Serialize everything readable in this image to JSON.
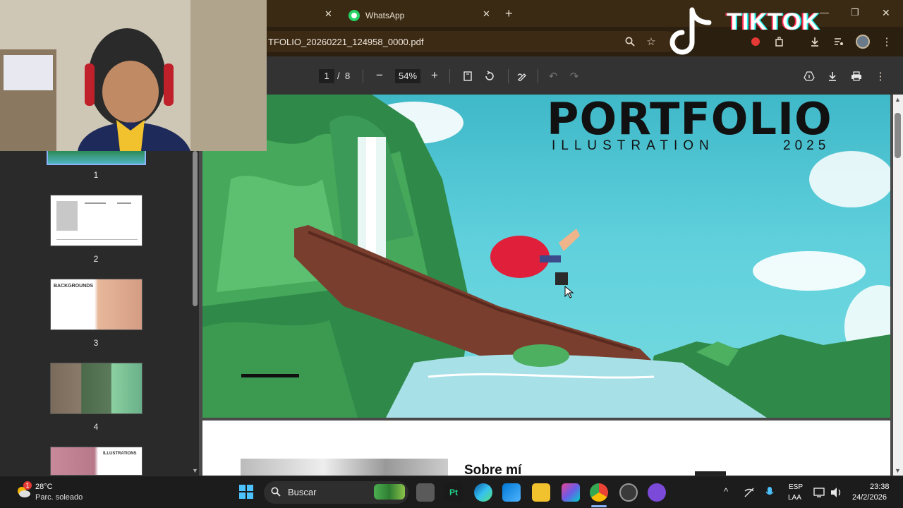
{
  "browser": {
    "tabs": [
      {
        "label": "",
        "close_glyph": "✕"
      },
      {
        "label": "WhatsApp",
        "close_glyph": "✕"
      }
    ],
    "new_tab_glyph": "+",
    "window_controls": {
      "minimize": "—",
      "restore": "❐",
      "close": "✕"
    },
    "url": "TFOLIO_20260221_124958_0000.pdf",
    "icons": [
      "zoom-icon",
      "star-icon",
      "extension-icon",
      "record-icon",
      "puzzle-icon",
      "download-icon",
      "media-icon",
      "profile-avatar",
      "menu-icon"
    ],
    "menu_glyph": "⋮"
  },
  "overlay": {
    "tiktok_text": "TIKTOK"
  },
  "pdf_toolbar": {
    "current_page": "1",
    "page_separator": "/",
    "total_pages": "8",
    "zoom_out_glyph": "−",
    "zoom_value": "54%",
    "zoom_in_glyph": "+",
    "menu_glyph": "⋮"
  },
  "sidebar": {
    "thumbnails": [
      {
        "num": "1",
        "caption": ""
      },
      {
        "num": "2",
        "caption": ""
      },
      {
        "num": "3",
        "caption": "BACKGROUNDS"
      },
      {
        "num": "4",
        "caption": ""
      },
      {
        "num": "",
        "caption": "ILLUSTRATIONS"
      }
    ]
  },
  "document": {
    "page1": {
      "title": "PORTFOLIO",
      "subtitle": "ILLUSTRATION",
      "year": "2025"
    },
    "page2": {
      "heading": "Sobre mí"
    }
  },
  "taskbar": {
    "weather_temp": "28°C",
    "weather_desc": "Parc. soleado",
    "weather_badge": "1",
    "search_placeholder": "Buscar",
    "lang_line1": "ESP",
    "lang_line2": "LAA",
    "time": "23:38",
    "date": "24/2/2026",
    "tray_chevron": "^"
  },
  "colors": {
    "tab_bar": "#3a2a14",
    "pdf_toolbar": "#333333",
    "sidebar": "#2a2a2a",
    "whatsapp_green": "#25d366",
    "taskbar": "#1c1c1c"
  }
}
